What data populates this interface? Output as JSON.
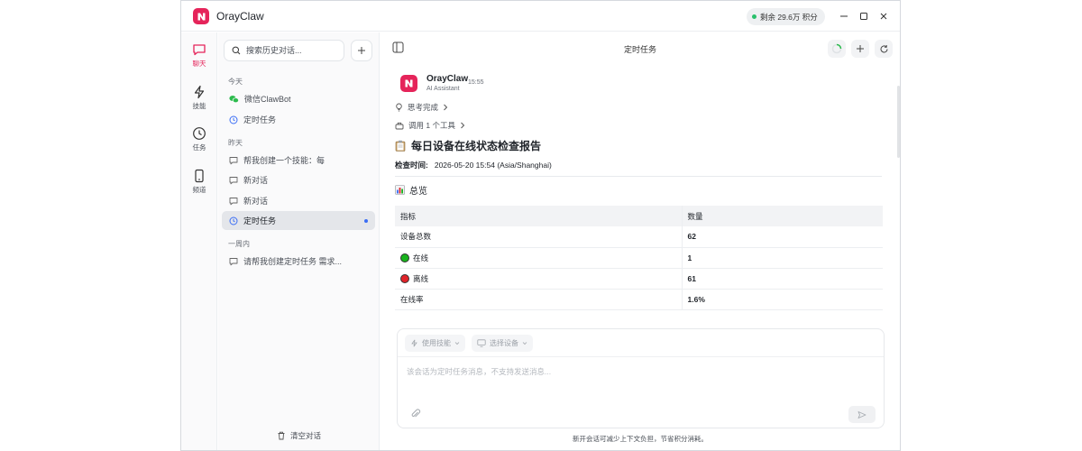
{
  "app": {
    "title": "OrayClaw",
    "credits": "剩余 29.6万 积分",
    "accent": "#e5245a"
  },
  "rail": [
    {
      "label": "聊天",
      "icon": "chat-icon"
    },
    {
      "label": "技能",
      "icon": "lightning-icon"
    },
    {
      "label": "任务",
      "icon": "clock-icon"
    },
    {
      "label": "频道",
      "icon": "phone-icon"
    }
  ],
  "sidebar": {
    "search_placeholder": "搜索历史对话...",
    "groups": [
      {
        "label": "今天",
        "items": [
          {
            "label": "微信ClawBot",
            "icon": "wechat-icon"
          },
          {
            "label": "定时任务",
            "icon": "clock-icon"
          }
        ]
      },
      {
        "label": "昨天",
        "items": [
          {
            "label": "帮我创建一个技能：每",
            "icon": "chat-bubble-icon"
          },
          {
            "label": "新对话",
            "icon": "chat-bubble-icon"
          },
          {
            "label": "新对话",
            "icon": "chat-bubble-icon"
          },
          {
            "label": "定时任务",
            "icon": "clock-icon"
          }
        ]
      },
      {
        "label": "一周内",
        "items": [
          {
            "label": "请帮我创建定时任务 需求...",
            "icon": "chat-bubble-icon"
          }
        ]
      }
    ],
    "clear_label": "清空对话"
  },
  "main": {
    "title": "定时任务",
    "message": {
      "name": "OrayClaw",
      "role": "AI Assistant",
      "time": "15:55",
      "thinking": "思考完成",
      "tool_call": "调用 1 个工具",
      "report_title": "每日设备在线状态检查报告",
      "check_label": "检查时间:",
      "check_value": "2026-05-20 15:54 (Asia/Shanghai)",
      "overview": "总览",
      "table": {
        "headers": [
          "指标",
          "数量"
        ],
        "rows": [
          {
            "metric": "设备总数",
            "value": "62"
          },
          {
            "metric": "在线",
            "value": "1",
            "dot": "#19b31d"
          },
          {
            "metric": "离线",
            "value": "61",
            "dot": "#e0242a"
          },
          {
            "metric": "在线率",
            "value": "1.6%"
          }
        ]
      }
    },
    "composer": {
      "skill_chip": "使用技能",
      "device_chip": "选择设备",
      "placeholder": "该会话为定时任务消息，不支持发送消息...",
      "footnote": "新开会话可减少上下文负担，节省积分消耗。"
    }
  }
}
